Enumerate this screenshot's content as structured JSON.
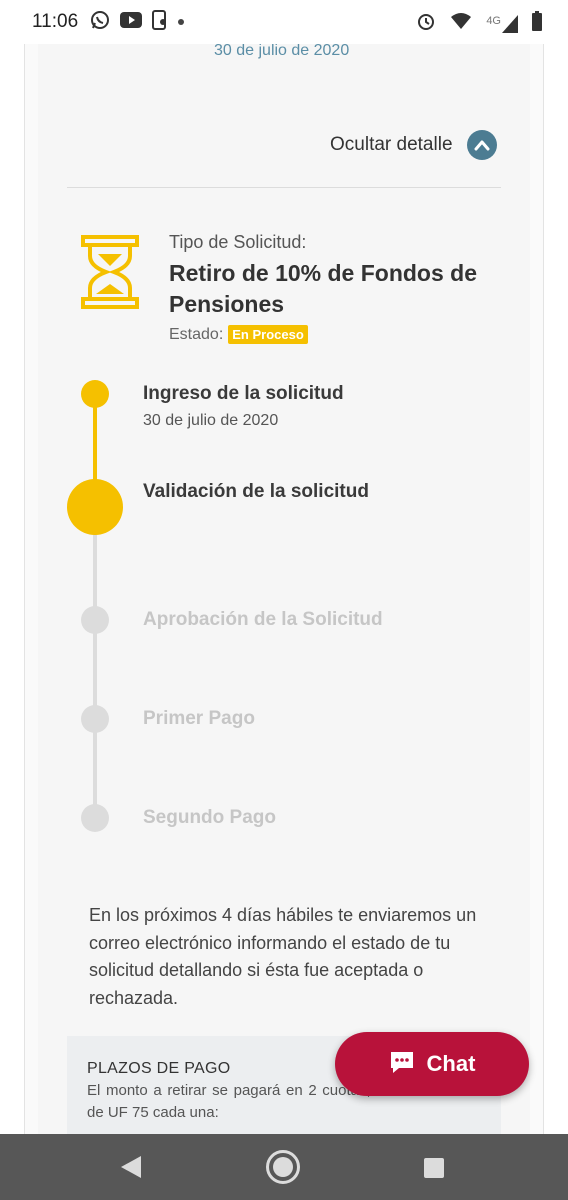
{
  "status_bar": {
    "time": "11:06",
    "network": "4G",
    "left_icons": [
      "whatsapp-icon",
      "youtube-icon",
      "phone-sync-icon",
      "notification-dot-icon"
    ],
    "right_icons": [
      "alarm-icon",
      "wifi-icon",
      "signal-icon",
      "battery-icon"
    ]
  },
  "header": {
    "date": "30 de julio de 2020",
    "hide_detail_label": "Ocultar detalle"
  },
  "request": {
    "type_label": "Tipo de Solicitud:",
    "type_value": "Retiro de 10% de Fondos de Pensiones",
    "state_label": "Estado:",
    "state_value": "En Proceso"
  },
  "timeline": {
    "steps": [
      {
        "label": "Ingreso de la solicitud",
        "date": "30 de julio de 2020",
        "status": "done"
      },
      {
        "label": "Validación de la solicitud",
        "status": "current"
      },
      {
        "label": "Aprobación de la Solicitud",
        "status": "pending"
      },
      {
        "label": "Primer Pago",
        "status": "pending"
      },
      {
        "label": "Segundo Pago",
        "status": "pending"
      }
    ]
  },
  "info": {
    "text": "En los próximos 4 días hábiles te enviaremos un correo electrónico informando el estado de tu solicitud detallando si ésta fue aceptada o rechazada."
  },
  "payment_terms": {
    "title": "PLAZOS DE PAGO",
    "text": "El monto a retirar se pagará en 2 cuotas, con un máximo de UF 75 cada una:"
  },
  "chat": {
    "label": "Chat"
  },
  "colors": {
    "accent_yellow": "#f5c000",
    "chat_red": "#b8123a",
    "toggle_blue": "#4c7c92",
    "date_blue": "#5b8ea6"
  }
}
